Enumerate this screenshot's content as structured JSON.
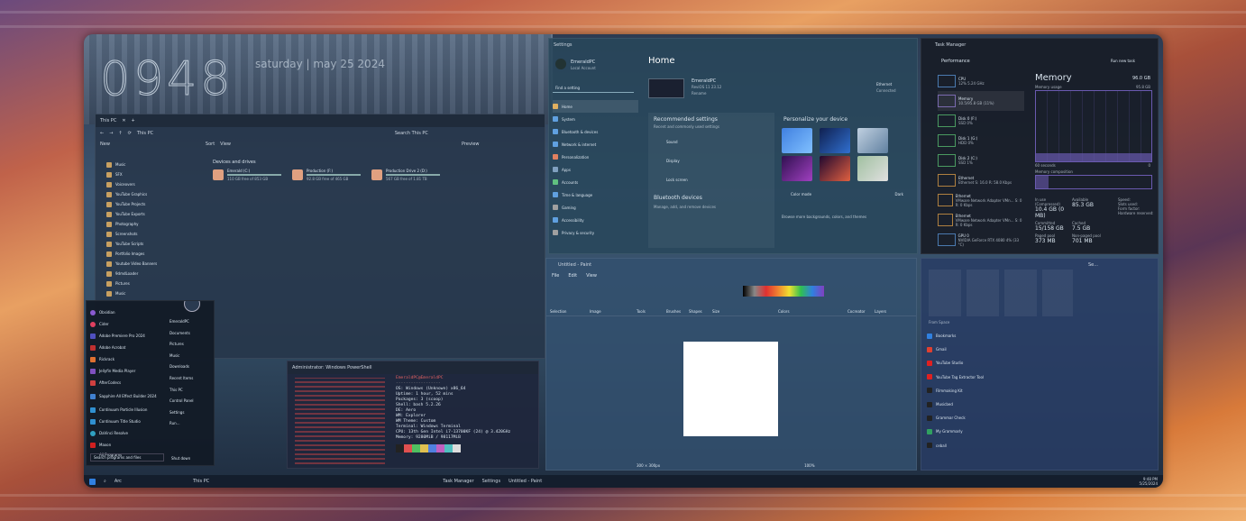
{
  "clock": {
    "time": "0948",
    "date": "saturday | may 25 2024"
  },
  "explorer": {
    "tab": "This PC",
    "breadcrumb": "This PC",
    "search": "Search This PC",
    "new": "New",
    "sort": "Sort",
    "view": "View",
    "preview": "Preview",
    "section": "Devices and drives",
    "sidebar": [
      "Music",
      "SFX",
      "Voiceovers",
      "YouTube Graphics",
      "YouTube Projects",
      "YouTube Exports",
      "Photography",
      "Screenshots",
      "YouTube Scripts",
      "Portfolio Images",
      "Youtube Video Banners",
      "9dmdLoader",
      "Pictures",
      "Music"
    ],
    "drives": [
      {
        "name": "Emerald (C:)",
        "free": "110 GB free of 853 GB"
      },
      {
        "name": "Production (F:)",
        "free": "92.8 GB free of 465 GB"
      },
      {
        "name": "Production Drive 2 (D:)",
        "free": "567 GB free of 1.81 TB"
      }
    ]
  },
  "start": {
    "apps": [
      "Obsidian",
      "Cider",
      "Adobe Premiere Pro 2024",
      "Adobe Acrobat",
      "Rickrack",
      "Jellyfin Media Player",
      "AfterCodecs",
      "Sapphire All Effect Builder 2024",
      "Continuum Particle Illusion",
      "Continuum Title Studio",
      "DaVinci Resolve",
      "Maxon"
    ],
    "places": [
      "EmeraldPC",
      "Documents",
      "Pictures",
      "Music",
      "Downloads",
      "Recent Items",
      "This PC",
      "Control Panel",
      "Settings",
      "Run..."
    ],
    "all_programs": "All Programs",
    "search": "Search programs and files",
    "shutdown": "Shut down"
  },
  "powershell": {
    "title": "Administrator: Windows PowerShell",
    "user": "EmeraldPC@EmeraldPC",
    "lines": [
      "OS: Windows (Unknown) x86_64",
      "Uptime: 1 hour, 52 mins",
      "Packages: 3 (scoop)",
      "Shell: bash 5.2.26",
      "DE: Aero",
      "WM: Explorer",
      "WM Theme: Custom",
      "Terminal: Windows Terminal",
      "CPU: 13th Gen Intel i7-13700KF (24) @ 3.420GHz",
      "Memory: 9280MiB / 98117MiB"
    ],
    "swatches": [
      "#222222",
      "#e05050",
      "#50c060",
      "#e0c050",
      "#5080e0",
      "#c060c0",
      "#50c0c0",
      "#dddddd"
    ]
  },
  "settings": {
    "title": "Settings",
    "user": "EmeraldPC",
    "account": "Local Account",
    "search": "Find a setting",
    "home": "Home",
    "pcname": "EmeraldPC",
    "os": "ReviOS 11 23.12",
    "rename": "Rename",
    "net": "Ethernet",
    "net_status": "Connected",
    "nav": [
      "Home",
      "System",
      "Bluetooth & devices",
      "Network & internet",
      "Personalization",
      "Apps",
      "Accounts",
      "Time & language",
      "Gaming",
      "Accessibility",
      "Privacy & security"
    ],
    "rec_title": "Recommended settings",
    "rec_sub": "Recent and commonly used settings",
    "rec": [
      "Sound",
      "Display",
      "Lock screen"
    ],
    "bt_title": "Bluetooth devices",
    "bt_sub": "Manage, add, and remove devices",
    "pers_title": "Personalize your device",
    "color_mode": "Color mode",
    "color_val": "Dark",
    "browse": "Browse more backgrounds, colors, and themes"
  },
  "taskmgr": {
    "title": "Task Manager",
    "section": "Performance",
    "run": "Run new task",
    "items": [
      {
        "name": "CPU",
        "sub": "12% 5.24 GHz"
      },
      {
        "name": "Memory",
        "sub": "10.5/95.8 GB (11%)"
      },
      {
        "name": "Disk 0 (F:)",
        "sub": "SSD 0%"
      },
      {
        "name": "Disk 1 (G:)",
        "sub": "HDD 0%"
      },
      {
        "name": "Disk 2 (C:)",
        "sub": "SSD 1%"
      },
      {
        "name": "Ethernet",
        "sub": "Ethernet S: 16.0 R: 58.0 Kbps"
      },
      {
        "name": "Ethernet",
        "sub": "VMware Network Adapter VMn... S: 0 R: 0 Kbps"
      },
      {
        "name": "Ethernet",
        "sub": "VMware Network Adapter VMn... S: 0 R: 0 Kbps"
      },
      {
        "name": "GPU 0",
        "sub": "NVIDIA GeForce RTX 4080 4% (33 °C)"
      }
    ],
    "mem_title": "Memory",
    "mem_total": "96.0 GB",
    "usage_label": "Memory usage",
    "usage_max": "95.8 GB",
    "seconds": "60 seconds",
    "zero": "0",
    "composition": "Memory composition",
    "stats": [
      {
        "label": "In use (Compressed)",
        "value": "10.4 GB (0 MB)"
      },
      {
        "label": "Available",
        "value": "85.3 GB"
      },
      {
        "label": "Committed",
        "value": "15/158 GB"
      },
      {
        "label": "Cached",
        "value": "7.5 GB"
      },
      {
        "label": "Paged pool",
        "value": "373 MB"
      },
      {
        "label": "Non-paged pool",
        "value": "701 MB"
      }
    ],
    "right": [
      "Speed:",
      "Slots used:",
      "Form factor:",
      "Hardware reserved:"
    ]
  },
  "paint": {
    "title": "Untitled - Paint",
    "menu": [
      "File",
      "Edit",
      "View"
    ],
    "groups": [
      "Selection",
      "Image",
      "Tools",
      "Brushes",
      "Shapes",
      "Size",
      "Colors",
      "Cocreator",
      "Layers"
    ],
    "canvas": "300 × 300px",
    "zoom": "100%"
  },
  "browser": {
    "title": "Se...",
    "bookmarks": [
      "Bookmarks",
      "Gmail",
      "YouTube Studio",
      "YouTube Tag Extractor Tool",
      "Filmmaking Kit",
      "Musicbed",
      "Grammar Check",
      "My Grammarly",
      "ceball"
    ],
    "header": "From Space"
  },
  "taskbar": {
    "items": [
      "Arc",
      "This PC",
      "Task Manager",
      "Settings",
      "Untitled - Paint"
    ],
    "time": "9:48 PM",
    "date": "5/25/2024"
  }
}
